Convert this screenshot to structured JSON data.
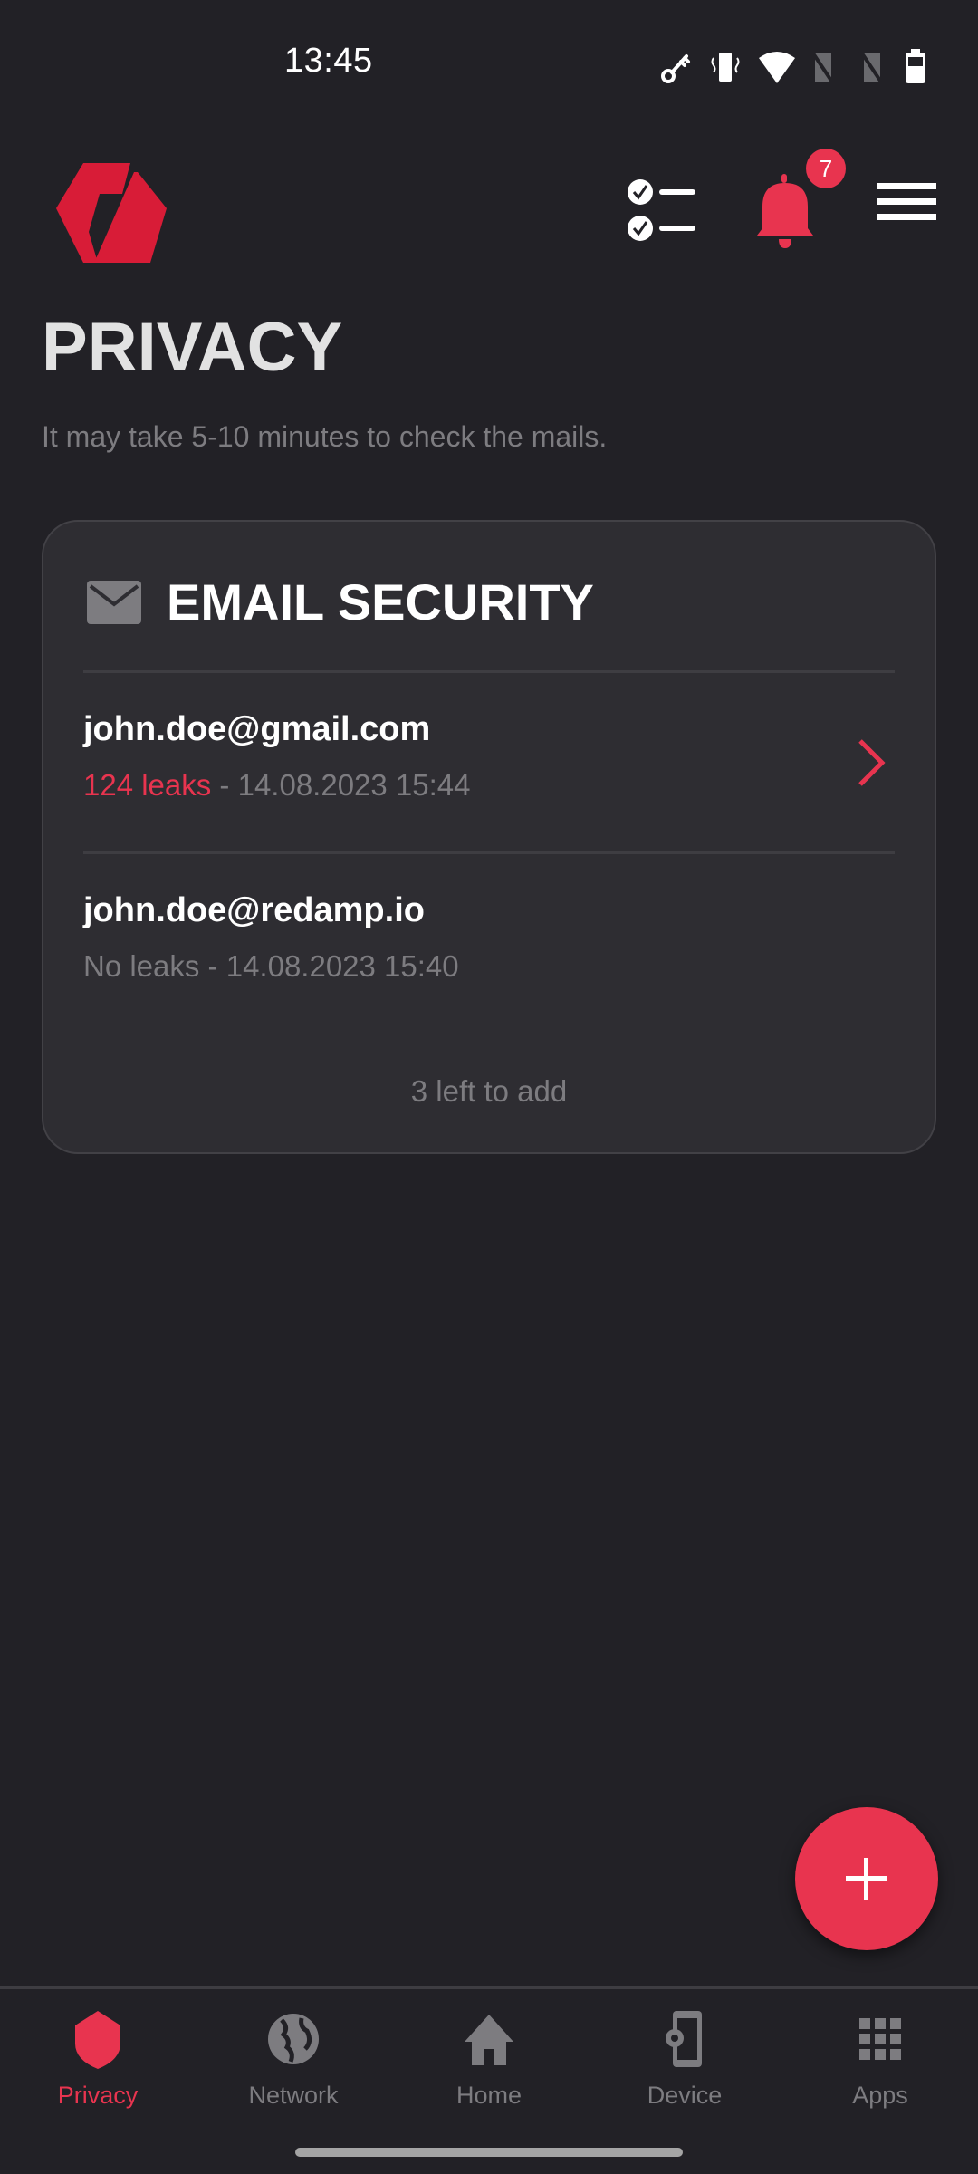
{
  "status_bar": {
    "time": "13:45",
    "icons": [
      "vpn-key-icon",
      "vibrate-icon",
      "wifi-icon",
      "no-sim-icon",
      "no-sim-icon",
      "battery-icon"
    ]
  },
  "header": {
    "logo": "redamp-logo",
    "notification_count": "7",
    "icons": [
      "tasks-checklist-icon",
      "bell-icon",
      "hamburger-menu-icon"
    ]
  },
  "page": {
    "title": "PRIVACY",
    "subtitle": "It may take 5-10 minutes to check the mails."
  },
  "email_security": {
    "title": "EMAIL SECURITY",
    "icon": "mail-icon",
    "emails": [
      {
        "address": "john.doe@gmail.com",
        "leaks": "124 leaks",
        "separator": " - ",
        "timestamp": "14.08.2023 15:44",
        "has_leaks": true
      },
      {
        "address": "john.doe@redamp.io",
        "leaks": "No leaks",
        "separator": " - ",
        "timestamp": "14.08.2023 15:40",
        "has_leaks": false
      }
    ],
    "left_to_add": "3 left to add"
  },
  "fab": {
    "icon": "plus-icon"
  },
  "bottom_nav": {
    "items": [
      {
        "label": "Privacy",
        "icon": "shield-icon",
        "active": true
      },
      {
        "label": "Network",
        "icon": "globe-icon",
        "active": false
      },
      {
        "label": "Home",
        "icon": "home-icon",
        "active": false
      },
      {
        "label": "Device",
        "icon": "device-settings-icon",
        "active": false
      },
      {
        "label": "Apps",
        "icon": "apps-grid-icon",
        "active": false
      }
    ]
  },
  "colors": {
    "accent": "#e8344f",
    "background": "#222126",
    "card": "#2e2d32",
    "muted_text": "#7d7c80"
  }
}
